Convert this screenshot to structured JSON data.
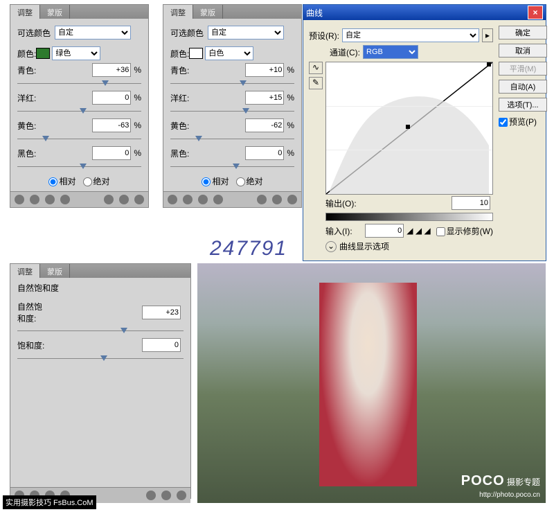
{
  "panelA": {
    "tab1": "调整",
    "tab2": "蒙版",
    "title": "可选颜色",
    "preset": "自定",
    "colorLabel": "颜色:",
    "colorName": "绿色",
    "colorHex": "#2d7a2d",
    "rows": [
      [
        "青色:",
        "+36",
        "%",
        68
      ],
      [
        "洋红:",
        "0",
        "%",
        50
      ],
      [
        "黄色:",
        "-63",
        "%",
        20
      ],
      [
        "黑色:",
        "0",
        "%",
        50
      ]
    ],
    "r1": "相对",
    "r2": "绝对"
  },
  "panelB": {
    "tab1": "调整",
    "tab2": "蒙版",
    "title": "可选颜色",
    "preset": "自定",
    "colorLabel": "颜色:",
    "colorName": "白色",
    "colorHex": "#ffffff",
    "rows": [
      [
        "青色:",
        "+10",
        "%",
        56
      ],
      [
        "洋红:",
        "+15",
        "%",
        58
      ],
      [
        "黄色:",
        "-62",
        "%",
        20
      ],
      [
        "黑色:",
        "0",
        "%",
        50
      ]
    ],
    "r1": "相对",
    "r2": "绝对"
  },
  "curves": {
    "title": "曲线",
    "presetLabel": "预设(R):",
    "preset": "自定",
    "channelLabel": "通道(C):",
    "channel": "RGB",
    "outputLabel": "输出(O):",
    "output": "10",
    "inputLabel": "输入(I):",
    "input": "0",
    "showClipping": "显示修剪(W)",
    "displayOptions": "曲线显示选项",
    "preview": "预览(P)",
    "btnOk": "确定",
    "btnCancel": "取消",
    "btnSmooth": "平滑(M)",
    "btnAuto": "自动(A)",
    "btnOptions": "选项(T)..."
  },
  "panelC": {
    "tab1": "调整",
    "tab2": "蒙版",
    "title": "自然饱和度",
    "rows": [
      [
        "自然饱和度:",
        "+23",
        62
      ],
      [
        "饱和度:",
        "0",
        50
      ]
    ]
  },
  "watermark": "247791",
  "fsbus": "实用摄影技巧 FsBus.CoM",
  "poco": {
    "brand": "POCO",
    "topic": "摄影专题",
    "url": "http://photo.poco.cn"
  }
}
